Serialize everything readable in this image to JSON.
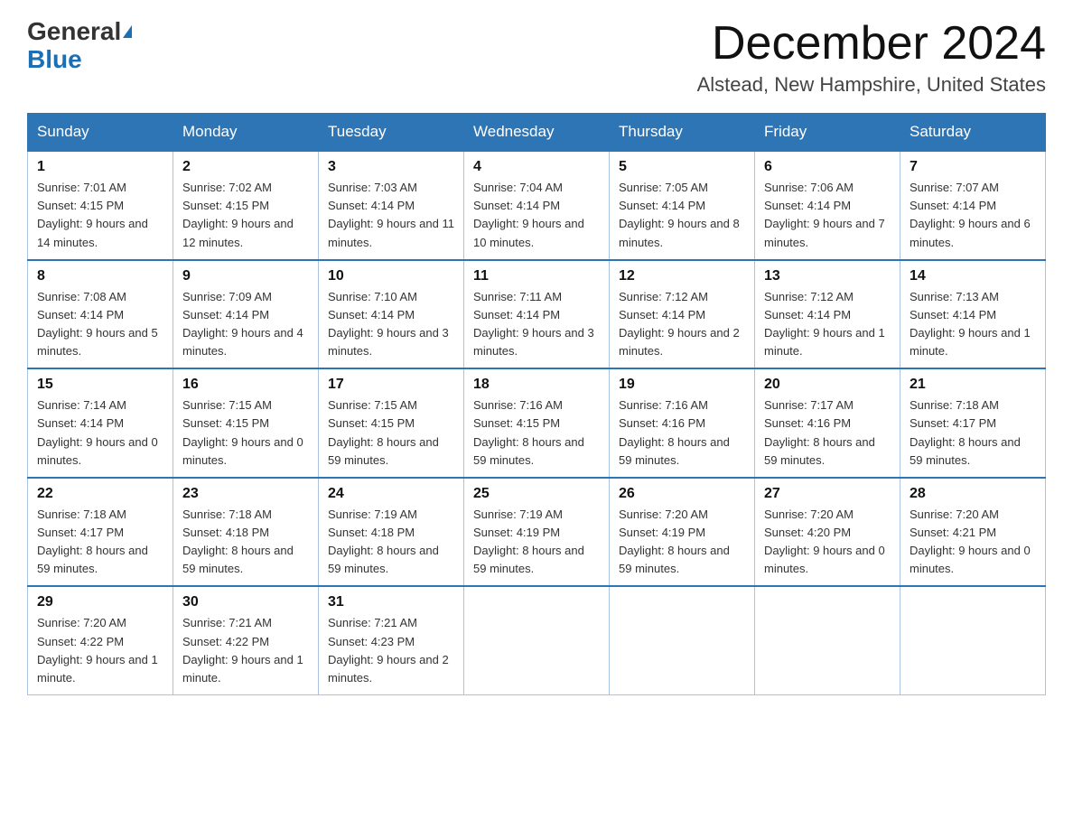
{
  "header": {
    "logo_general": "General",
    "logo_blue": "Blue",
    "month_title": "December 2024",
    "location": "Alstead, New Hampshire, United States"
  },
  "days_of_week": [
    "Sunday",
    "Monday",
    "Tuesday",
    "Wednesday",
    "Thursday",
    "Friday",
    "Saturday"
  ],
  "weeks": [
    [
      {
        "day": "1",
        "sunrise": "7:01 AM",
        "sunset": "4:15 PM",
        "daylight": "9 hours and 14 minutes."
      },
      {
        "day": "2",
        "sunrise": "7:02 AM",
        "sunset": "4:15 PM",
        "daylight": "9 hours and 12 minutes."
      },
      {
        "day": "3",
        "sunrise": "7:03 AM",
        "sunset": "4:14 PM",
        "daylight": "9 hours and 11 minutes."
      },
      {
        "day": "4",
        "sunrise": "7:04 AM",
        "sunset": "4:14 PM",
        "daylight": "9 hours and 10 minutes."
      },
      {
        "day": "5",
        "sunrise": "7:05 AM",
        "sunset": "4:14 PM",
        "daylight": "9 hours and 8 minutes."
      },
      {
        "day": "6",
        "sunrise": "7:06 AM",
        "sunset": "4:14 PM",
        "daylight": "9 hours and 7 minutes."
      },
      {
        "day": "7",
        "sunrise": "7:07 AM",
        "sunset": "4:14 PM",
        "daylight": "9 hours and 6 minutes."
      }
    ],
    [
      {
        "day": "8",
        "sunrise": "7:08 AM",
        "sunset": "4:14 PM",
        "daylight": "9 hours and 5 minutes."
      },
      {
        "day": "9",
        "sunrise": "7:09 AM",
        "sunset": "4:14 PM",
        "daylight": "9 hours and 4 minutes."
      },
      {
        "day": "10",
        "sunrise": "7:10 AM",
        "sunset": "4:14 PM",
        "daylight": "9 hours and 3 minutes."
      },
      {
        "day": "11",
        "sunrise": "7:11 AM",
        "sunset": "4:14 PM",
        "daylight": "9 hours and 3 minutes."
      },
      {
        "day": "12",
        "sunrise": "7:12 AM",
        "sunset": "4:14 PM",
        "daylight": "9 hours and 2 minutes."
      },
      {
        "day": "13",
        "sunrise": "7:12 AM",
        "sunset": "4:14 PM",
        "daylight": "9 hours and 1 minute."
      },
      {
        "day": "14",
        "sunrise": "7:13 AM",
        "sunset": "4:14 PM",
        "daylight": "9 hours and 1 minute."
      }
    ],
    [
      {
        "day": "15",
        "sunrise": "7:14 AM",
        "sunset": "4:14 PM",
        "daylight": "9 hours and 0 minutes."
      },
      {
        "day": "16",
        "sunrise": "7:15 AM",
        "sunset": "4:15 PM",
        "daylight": "9 hours and 0 minutes."
      },
      {
        "day": "17",
        "sunrise": "7:15 AM",
        "sunset": "4:15 PM",
        "daylight": "8 hours and 59 minutes."
      },
      {
        "day": "18",
        "sunrise": "7:16 AM",
        "sunset": "4:15 PM",
        "daylight": "8 hours and 59 minutes."
      },
      {
        "day": "19",
        "sunrise": "7:16 AM",
        "sunset": "4:16 PM",
        "daylight": "8 hours and 59 minutes."
      },
      {
        "day": "20",
        "sunrise": "7:17 AM",
        "sunset": "4:16 PM",
        "daylight": "8 hours and 59 minutes."
      },
      {
        "day": "21",
        "sunrise": "7:18 AM",
        "sunset": "4:17 PM",
        "daylight": "8 hours and 59 minutes."
      }
    ],
    [
      {
        "day": "22",
        "sunrise": "7:18 AM",
        "sunset": "4:17 PM",
        "daylight": "8 hours and 59 minutes."
      },
      {
        "day": "23",
        "sunrise": "7:18 AM",
        "sunset": "4:18 PM",
        "daylight": "8 hours and 59 minutes."
      },
      {
        "day": "24",
        "sunrise": "7:19 AM",
        "sunset": "4:18 PM",
        "daylight": "8 hours and 59 minutes."
      },
      {
        "day": "25",
        "sunrise": "7:19 AM",
        "sunset": "4:19 PM",
        "daylight": "8 hours and 59 minutes."
      },
      {
        "day": "26",
        "sunrise": "7:20 AM",
        "sunset": "4:19 PM",
        "daylight": "8 hours and 59 minutes."
      },
      {
        "day": "27",
        "sunrise": "7:20 AM",
        "sunset": "4:20 PM",
        "daylight": "9 hours and 0 minutes."
      },
      {
        "day": "28",
        "sunrise": "7:20 AM",
        "sunset": "4:21 PM",
        "daylight": "9 hours and 0 minutes."
      }
    ],
    [
      {
        "day": "29",
        "sunrise": "7:20 AM",
        "sunset": "4:22 PM",
        "daylight": "9 hours and 1 minute."
      },
      {
        "day": "30",
        "sunrise": "7:21 AM",
        "sunset": "4:22 PM",
        "daylight": "9 hours and 1 minute."
      },
      {
        "day": "31",
        "sunrise": "7:21 AM",
        "sunset": "4:23 PM",
        "daylight": "9 hours and 2 minutes."
      },
      null,
      null,
      null,
      null
    ]
  ]
}
